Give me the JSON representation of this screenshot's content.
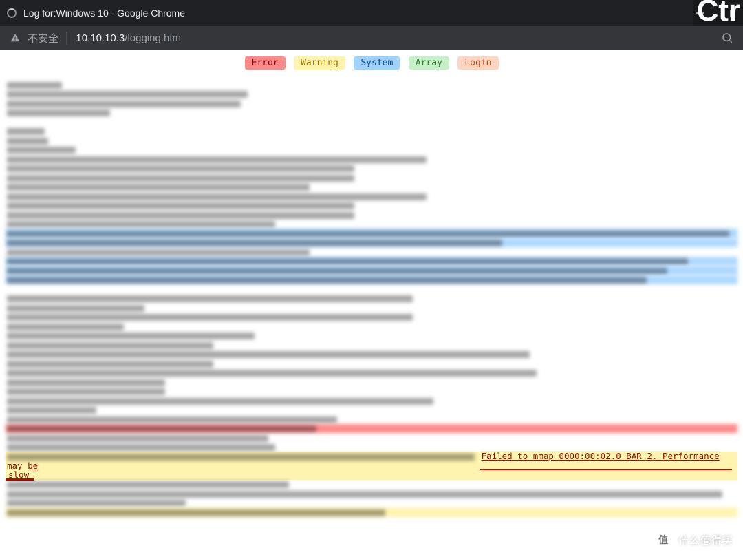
{
  "window": {
    "title": "Log for:Windows 10 - Google Chrome",
    "kb_hint": "Ctr"
  },
  "address": {
    "insecure_label": "不安全",
    "host": "10.10.10.3",
    "path": "/logging.htm"
  },
  "filters": {
    "error": "Error",
    "warning": "Warning",
    "system": "System",
    "array": "Array",
    "login": "Login"
  },
  "visible_warning": {
    "text": "Failed to mmap 0000:00:02.0 BAR 2. Performance may be",
    "continuation": "slow"
  },
  "watermark": {
    "badge": "值",
    "text": "什么值得买"
  },
  "icons": {
    "spinner": "loading-spinner-icon",
    "warn": "insecure-warning-icon",
    "search": "search-icon",
    "minimize": "minimize-icon",
    "maximize": "maximize-icon"
  }
}
